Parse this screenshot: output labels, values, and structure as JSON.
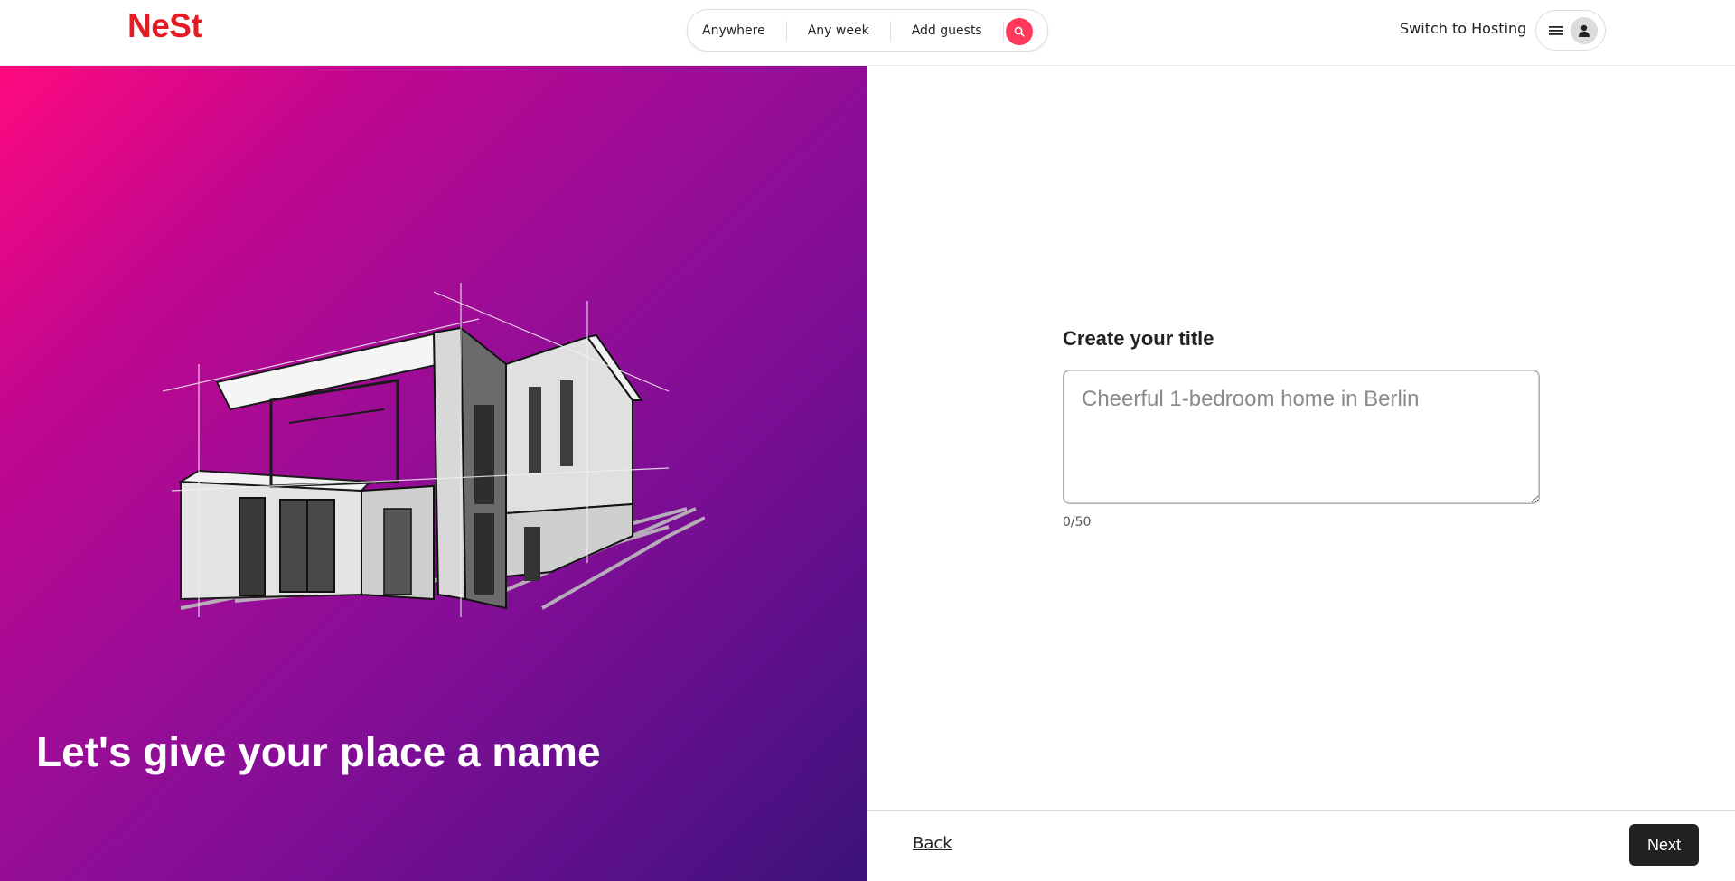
{
  "header": {
    "logo": "NeSt",
    "search": {
      "location": "Anywhere",
      "dates": "Any week",
      "guests": "Add guests"
    },
    "switch_hosting": "Switch to Hosting"
  },
  "hero": {
    "title": "Let's give your place a name"
  },
  "form": {
    "heading": "Create your title",
    "placeholder": "Cheerful 1-bedroom home in Berlin",
    "value": "",
    "char_count": "0/50"
  },
  "footer": {
    "back_label": "Back",
    "next_label": "Next"
  },
  "colors": {
    "brand": "#e31c25",
    "search_accent": "#ff385c",
    "next_button": "#222222"
  }
}
